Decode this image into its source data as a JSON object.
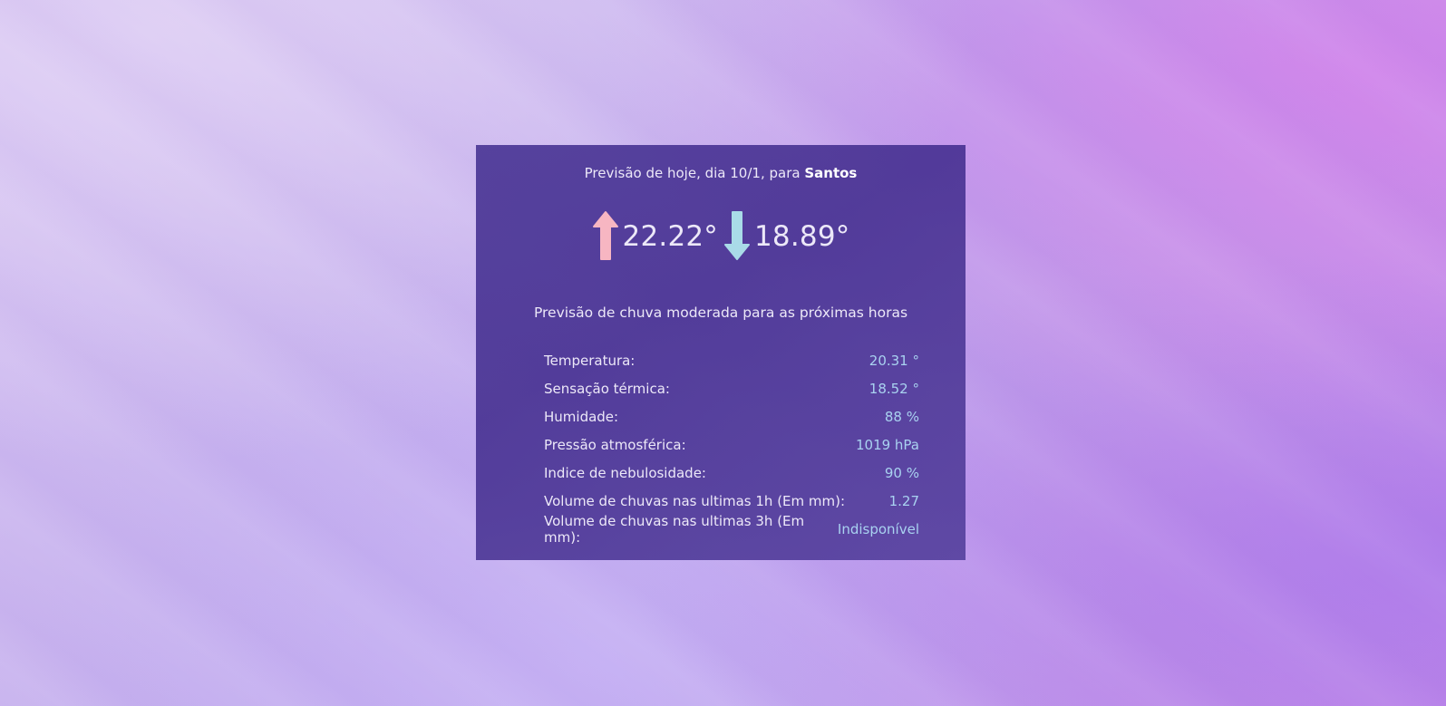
{
  "card": {
    "title_prefix": "Previsão de hoje, dia 10/1, para ",
    "city": "Santos",
    "max_temp": "22.22°",
    "min_temp": "18.89°",
    "forecast": "Previsão de chuva moderada para as próximas horas",
    "details": [
      {
        "label": "Temperatura:",
        "value": "20.31 °"
      },
      {
        "label": "Sensação térmica:",
        "value": "18.52 °"
      },
      {
        "label": "Humidade:",
        "value": "88 %"
      },
      {
        "label": "Pressão atmosférica:",
        "value": "1019 hPa"
      },
      {
        "label": "Indice de nebulosidade:",
        "value": "90 %"
      },
      {
        "label": "Volume de chuvas nas ultimas 1h (Em mm):",
        "value": "1.27"
      },
      {
        "label": "Volume de chuvas nas ultimas 3h (Em mm):",
        "value": "Indisponível"
      }
    ]
  },
  "icons": {
    "up": "arrow-up-icon",
    "down": "arrow-down-icon"
  },
  "colors": {
    "card_bg": "#4b3796",
    "up_arrow": "#f7b6c2",
    "down_arrow": "#a9dbe8",
    "value_text": "#a9d2f0"
  }
}
